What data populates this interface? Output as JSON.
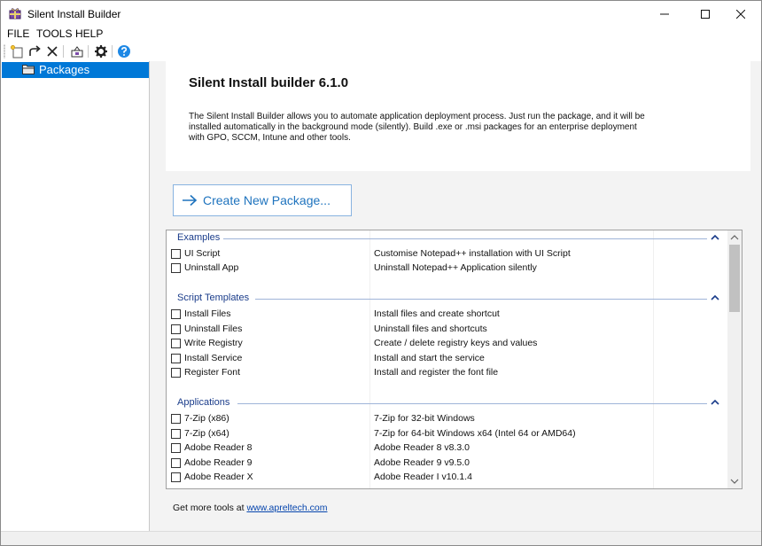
{
  "window": {
    "title": "Silent Install Builder",
    "controls": [
      "minimize-icon",
      "maximize-icon",
      "close-icon"
    ]
  },
  "menu": [
    "FILE",
    "TOOLS",
    "HELP"
  ],
  "toolbar": {
    "buttons": [
      "new-package-icon",
      "redo-icon",
      "delete-icon",
      "build-icon",
      "settings-icon",
      "help-icon"
    ]
  },
  "tree": {
    "items": [
      {
        "label": "Packages",
        "icon": "folder-icon",
        "selected": true
      }
    ]
  },
  "main": {
    "title": "Silent Install builder 6.1.0",
    "description": "The Silent Install Builder allows you to automate application deployment process. Just run the package, and it will be installed automatically in the background mode (silently).  Build .exe or .msi packages for an enterprise deployment with GPO, SCCM, Intune and other tools.",
    "create_button": "Create New Package...",
    "footer_text": "Get more tools at ",
    "footer_link": "www.apreltech.com"
  },
  "groups": [
    {
      "title": "Examples",
      "rows": [
        {
          "name": "UI Script",
          "desc": "Customise Notepad++ installation with UI Script"
        },
        {
          "name": "Uninstall App",
          "desc": "Uninstall Notepad++ Application silently"
        }
      ]
    },
    {
      "title": "Script Templates",
      "rows": [
        {
          "name": "Install Files",
          "desc": "Install files and create shortcut"
        },
        {
          "name": "Uninstall Files",
          "desc": "Uninstall files and shortcuts"
        },
        {
          "name": "Write Registry",
          "desc": "Create / delete registry keys and values"
        },
        {
          "name": "Install Service",
          "desc": "Install and start the service"
        },
        {
          "name": "Register Font",
          "desc": "Install and register the font file"
        }
      ]
    },
    {
      "title": "Applications",
      "rows": [
        {
          "name": "7-Zip (x86)",
          "desc": "7-Zip for 32-bit Windows"
        },
        {
          "name": "7-Zip (x64)",
          "desc": "7-Zip for 64-bit Windows x64 (Intel 64 or AMD64)"
        },
        {
          "name": "Adobe Reader 8",
          "desc": "Adobe Reader 8 v8.3.0"
        },
        {
          "name": "Adobe Reader 9",
          "desc": "Adobe Reader 9 v9.5.0"
        },
        {
          "name": "Adobe Reader X",
          "desc": "Adobe Reader I v10.1.4"
        }
      ]
    }
  ],
  "colors": {
    "selection": "#0078d7",
    "accent": "#1e73be",
    "group_title": "#1a3c8a"
  }
}
